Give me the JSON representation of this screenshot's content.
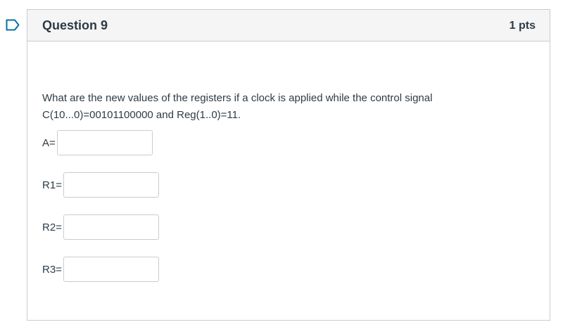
{
  "question": {
    "title": "Question 9",
    "points": "1 pts",
    "text_line1": "What are the new values of the registers if a clock is applied while the control signal",
    "text_line2": "C(10...0)=00101100000 and Reg(1..0)=11.",
    "answers": [
      {
        "label": "A=",
        "value": ""
      },
      {
        "label": "R1=",
        "value": ""
      },
      {
        "label": "R2=",
        "value": ""
      },
      {
        "label": "R3=",
        "value": ""
      }
    ]
  },
  "icons": {
    "flag": "bookmark-flag-icon"
  },
  "colors": {
    "flag_accent": "#0770a3",
    "header_bg": "#f5f5f5",
    "border": "#c7cdd1",
    "text": "#2d3b45"
  }
}
